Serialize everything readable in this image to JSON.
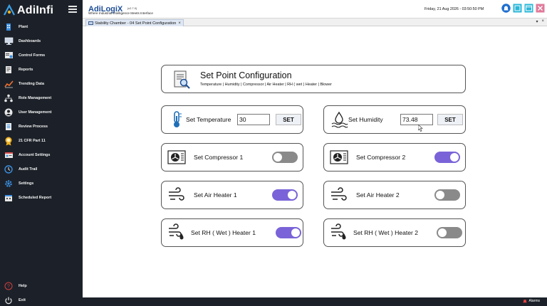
{
  "app": {
    "logo_text": "AdiInfi",
    "brand_name": "AdiLogiX",
    "brand_version": "(v2.7.0)",
    "tagline": "Where Industrial Intelligence Meets Interface",
    "datetime": "Friday, 21 Aug 2026 - 03:50:50 PM"
  },
  "sidebar": {
    "items": [
      {
        "label": "Plant",
        "icon": "building-icon"
      },
      {
        "label": "Dashboards",
        "icon": "monitor-icon"
      },
      {
        "label": "Control Forms",
        "icon": "form-icon"
      },
      {
        "label": "Reports",
        "icon": "report-icon"
      },
      {
        "label": "Trending Data",
        "icon": "trend-icon"
      },
      {
        "label": "Role Management",
        "icon": "hierarchy-icon"
      },
      {
        "label": "User Management",
        "icon": "user-icon"
      },
      {
        "label": "Review Process",
        "icon": "review-icon"
      },
      {
        "label": "21 CFR Part 11",
        "icon": "badge-icon"
      },
      {
        "label": "Account Settings",
        "icon": "account-icon"
      },
      {
        "label": "Audit Trail",
        "icon": "audit-icon"
      },
      {
        "label": "Settings",
        "icon": "gear-icon"
      },
      {
        "label": "Scheduled Report",
        "icon": "schedule-icon"
      }
    ],
    "help_label": "Help",
    "exit_label": "Exit"
  },
  "tab": {
    "label": "Stability Chamber - 04 Set Point Configuration",
    "close": "×",
    "ctrl_down": "▾",
    "ctrl_close": "×"
  },
  "panel": {
    "title": "Set Point Configuration",
    "subtitle": "Temperature | Humidity | Compressor | Air Heater | RH ( wet ) Heater | Blower"
  },
  "controls": {
    "temperature": {
      "label": "Set Temperature",
      "value": "30",
      "button": "SET"
    },
    "humidity": {
      "label": "Set Humidity",
      "value": "73.48",
      "button": "SET"
    },
    "compressor1": {
      "label": "Set Compressor 1",
      "state": "off"
    },
    "compressor2": {
      "label": "Set Compressor 2",
      "state": "on"
    },
    "airheater1": {
      "label": "Set Air Heater 1",
      "state": "on"
    },
    "airheater2": {
      "label": "Set Air Heater 2",
      "state": "off"
    },
    "rhheater1": {
      "label": "Set RH ( Wet ) Heater 1",
      "state": "on"
    },
    "rhheater2": {
      "label": "Set RH ( Wet ) Heater 2",
      "state": "off"
    }
  },
  "status": {
    "alarms_label": "Alarms"
  },
  "colors": {
    "sidebar_bg": "#1c2129",
    "toggle_on": "#7a63d8",
    "toggle_off": "#8a8a8a",
    "brand_blue": "#1f4e96"
  }
}
